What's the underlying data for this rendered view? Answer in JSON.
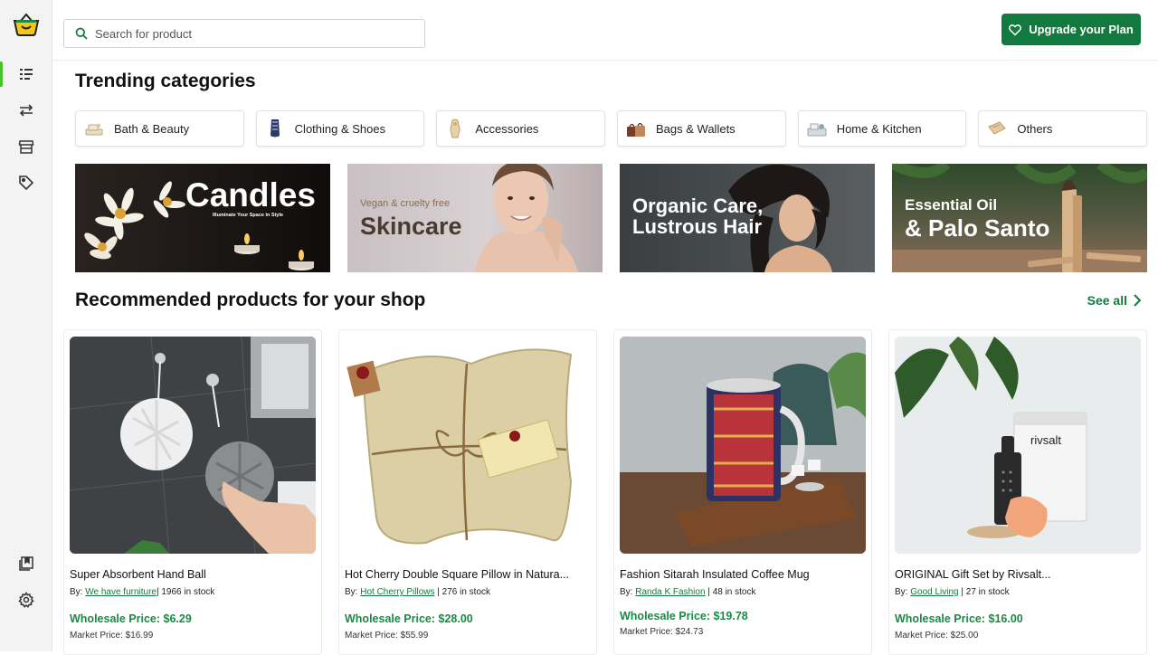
{
  "search": {
    "placeholder": "Search for product"
  },
  "header": {
    "upgrade_label": "Upgrade your Plan"
  },
  "sidebar": {
    "items": [
      {
        "name": "dashboard",
        "icon": "list-icon",
        "active": true
      },
      {
        "name": "transfers",
        "icon": "arrows-swap-icon",
        "active": false
      },
      {
        "name": "store",
        "icon": "storefront-icon",
        "active": false
      },
      {
        "name": "tags",
        "icon": "tag-icon",
        "active": false
      },
      {
        "name": "catalog",
        "icon": "bookmark-book-icon",
        "active": false
      },
      {
        "name": "settings",
        "icon": "gear-icon",
        "active": false
      }
    ]
  },
  "trending": {
    "title": "Trending categories",
    "categories": [
      {
        "label": "Bath & Beauty"
      },
      {
        "label": "Clothing & Shoes"
      },
      {
        "label": "Accessories"
      },
      {
        "label": "Bags & Wallets"
      },
      {
        "label": "Home & Kitchen"
      },
      {
        "label": "Others"
      }
    ]
  },
  "banners": [
    {
      "title": "Candles",
      "subtitle": "Illuminate Your Space in Style"
    },
    {
      "title": "Skincare",
      "subtitle": "Vegan & cruelty free"
    },
    {
      "title": "Organic Care,",
      "subtitle": "Lustrous Hair"
    },
    {
      "title": "Essential Oil",
      "subtitle": "& Palo Santo"
    }
  ],
  "recommended": {
    "title": "Recommended products for your shop",
    "see_all": "See all",
    "products": [
      {
        "name": "Super Absorbent Hand Ball",
        "by": "By:",
        "vendor": "We have furniture",
        "sep": "|",
        "stock": "1966 in stock",
        "wholesale": "Wholesale Price: $6.29",
        "market": "Market Price: $16.99"
      },
      {
        "name": "Hot Cherry Double Square Pillow in Natura...",
        "by": "By:",
        "vendor": "Hot Cherry Pillows",
        "sep": "|",
        "stock": "276 in stock",
        "wholesale": "Wholesale Price: $28.00",
        "market": "Market Price: $55.99"
      },
      {
        "name": "Fashion Sitarah Insulated Coffee Mug",
        "by": "By:",
        "vendor": "Randa K Fashion",
        "sep": "|",
        "stock": "48 in stock",
        "wholesale": "Wholesale Price: $19.78",
        "market": "Market Price: $24.73"
      },
      {
        "name": "ORIGINAL Gift Set by Rivsalt...",
        "by": "By:",
        "vendor": "Good Living",
        "sep": "|",
        "stock": "27 in stock",
        "wholesale": "Wholesale Price: $16.00",
        "market": "Market Price: $25.00",
        "product_text": "rivsalt"
      }
    ]
  },
  "colors": {
    "brand": "#137a3f",
    "active_nav": "#49c12a",
    "logo_yellow": "#f5c518"
  }
}
